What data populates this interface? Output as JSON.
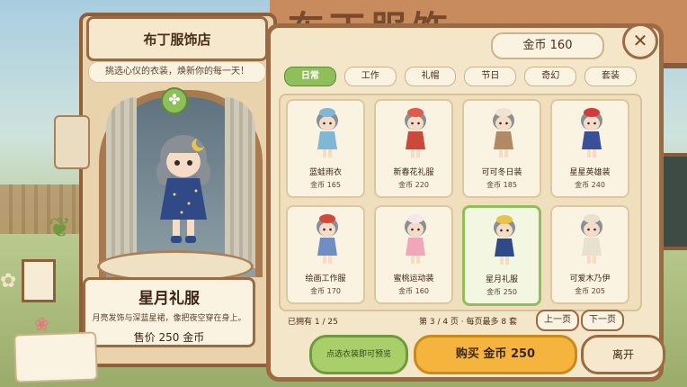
{
  "background": {
    "sign_text": "布丁服饰"
  },
  "shop": {
    "name": "布丁服饰店",
    "slogan": "挑选心仪的衣装，焕新你的每一天！"
  },
  "preview": {
    "name": "星月礼服",
    "description_line1": "月亮发饰与深蓝星裙，",
    "description_line2": "像把夜空穿在身上。",
    "price_label": "售价 250 金币"
  },
  "coins_label": "金币  160",
  "close_icon": "close-icon",
  "tabs": [
    {
      "label": "日常",
      "active": true
    },
    {
      "label": "工作",
      "active": false
    },
    {
      "label": "礼帽",
      "active": false
    },
    {
      "label": "节日",
      "active": false
    },
    {
      "label": "奇幻",
      "active": false
    },
    {
      "label": "套装",
      "active": false
    }
  ],
  "items": [
    {
      "name": "蓝蛙雨衣",
      "price": "金币 165",
      "selected": false,
      "color": "#7fb8d6",
      "hat": "#7fb8d6"
    },
    {
      "name": "新春花礼服",
      "price": "金币 220",
      "selected": false,
      "color": "#c94a3a",
      "hat": "#e05a4a"
    },
    {
      "name": "可可冬日装",
      "price": "金币 185",
      "selected": false,
      "color": "#b08a62",
      "hat": "#efe4d2"
    },
    {
      "name": "星星英雄装",
      "price": "金币 240",
      "selected": false,
      "color": "#3a4f9a",
      "hat": "#d23a3a"
    },
    {
      "name": "绘画工作服",
      "price": "金币 170",
      "selected": false,
      "color": "#6f8fc4",
      "hat": "#d2483a"
    },
    {
      "name": "蜜桃运动装",
      "price": "金币 160",
      "selected": false,
      "color": "#f0a8b8",
      "hat": "#f6e8ea"
    },
    {
      "name": "星月礼服",
      "price": "金币 250",
      "selected": true,
      "color": "#2f4a86",
      "hat": "#e8c44a"
    },
    {
      "name": "可爱木乃伊",
      "price": "金币 205",
      "selected": false,
      "color": "#e9e1cf",
      "hat": "#e9e1cf"
    }
  ],
  "footer": {
    "owned": "已拥有 1 / 25",
    "page_info": "第 3 / 4 页 · 每页最多 8 套",
    "prev_label": "上一页",
    "next_label": "下一页"
  },
  "actions": {
    "preview_label": "点选衣装即可预览",
    "buy_label": "购买  金币 250",
    "leave_label": "离开"
  }
}
